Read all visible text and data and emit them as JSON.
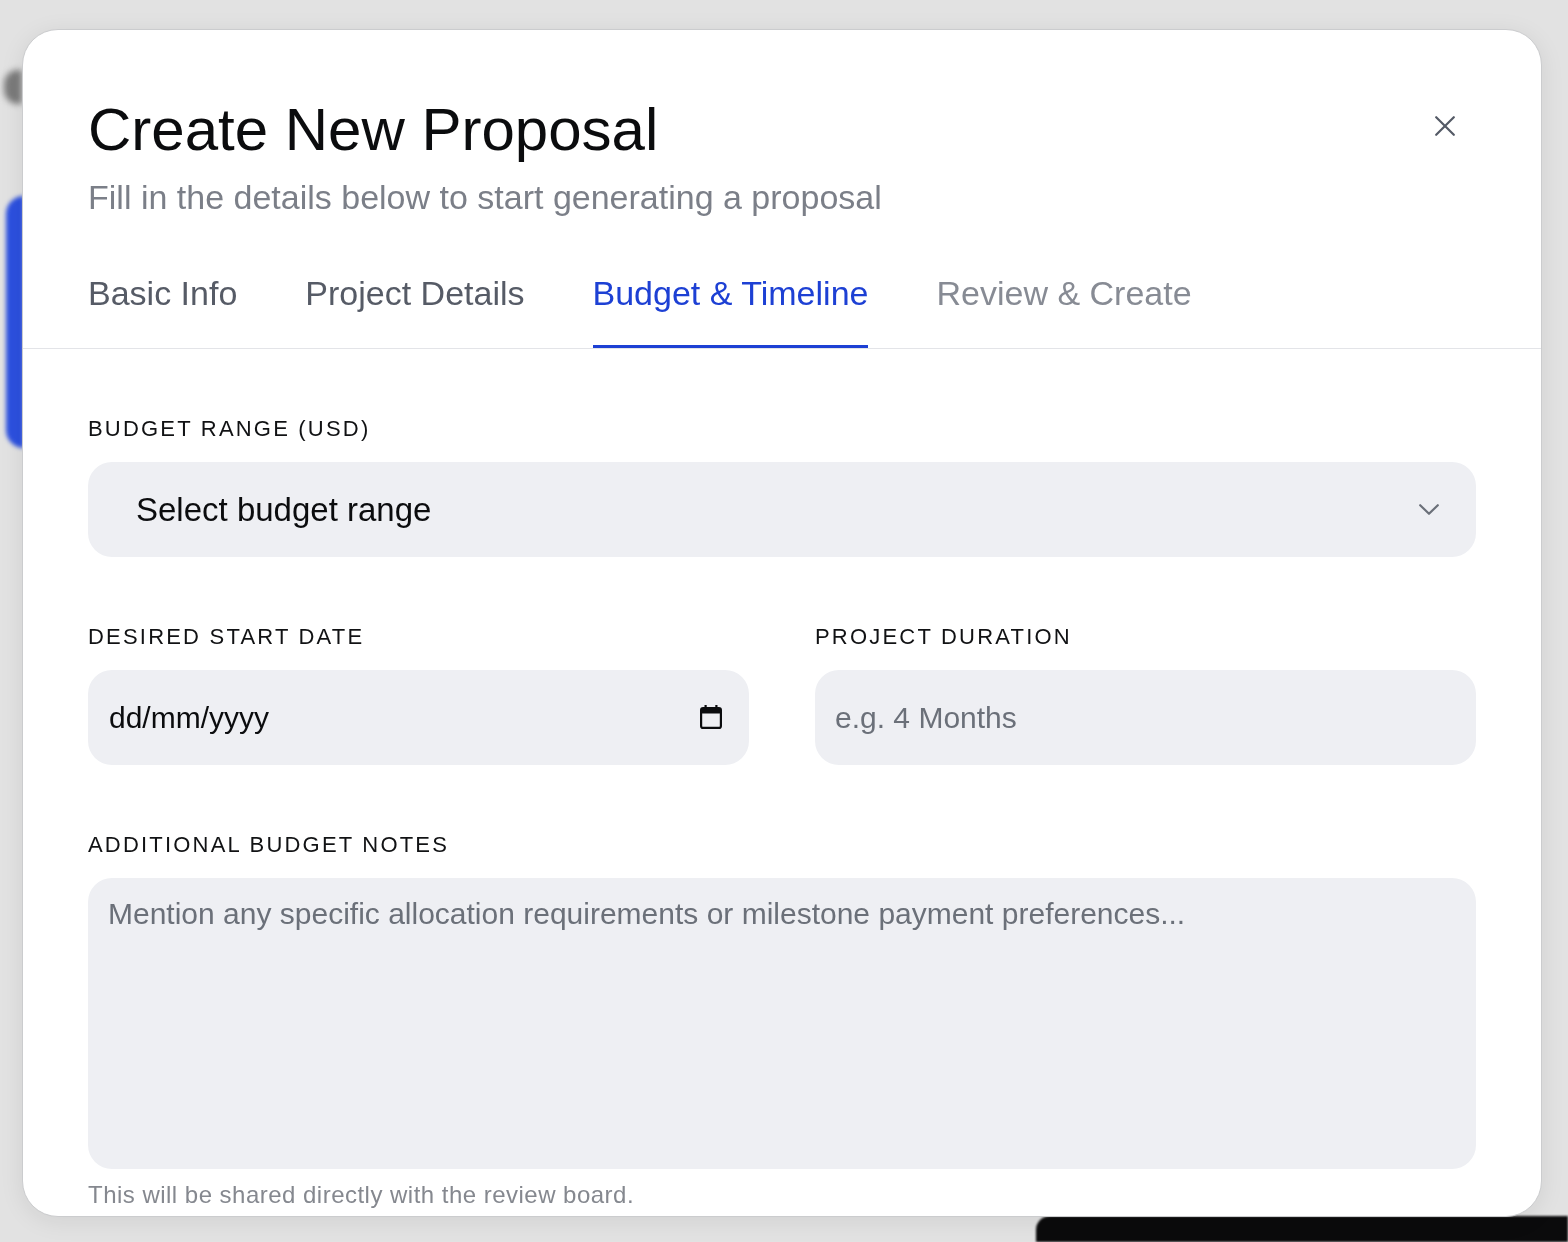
{
  "dialog": {
    "title": "Create New Proposal",
    "subtitle": "Fill in the details below to start generating a proposal"
  },
  "tabs": [
    {
      "label": "Basic Info",
      "selected": false,
      "disabled": false
    },
    {
      "label": "Project Details",
      "selected": false,
      "disabled": false
    },
    {
      "label": "Budget & Timeline",
      "selected": true,
      "disabled": false
    },
    {
      "label": "Review & Create",
      "selected": false,
      "disabled": true
    }
  ],
  "form": {
    "rows": [
      {
        "fields": [
          {
            "kind": "select",
            "label": "BUDGET RANGE (USD)",
            "placeholder": "Select budget range"
          }
        ]
      },
      {
        "fields": [
          {
            "kind": "date",
            "label": "DESIRED START DATE",
            "placeholder": "dd/mm/yyyy"
          },
          {
            "kind": "text",
            "label": "PROJECT DURATION",
            "placeholder": "e.g. 4 Months"
          }
        ]
      },
      {
        "fields": [
          {
            "kind": "textarea",
            "label": "ADDITIONAL BUDGET NOTES",
            "placeholder": "Mention any specific allocation requirements or milestone payment preferences...",
            "helper": "This will be shared directly with the review board."
          }
        ]
      }
    ]
  }
}
